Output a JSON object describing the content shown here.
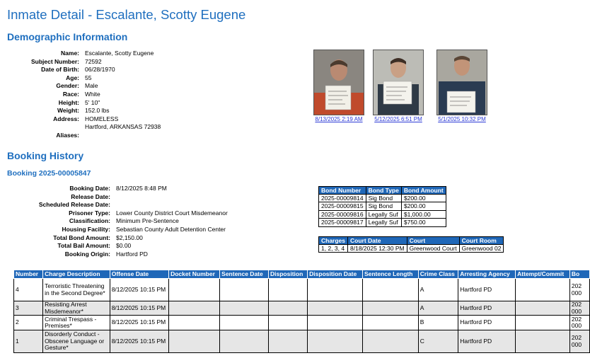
{
  "page_title": "Inmate Detail - Escalante, Scotty Eugene",
  "demographic": {
    "heading": "Demographic Information",
    "rows": [
      {
        "label": "Name:",
        "value": "Escalante, Scotty Eugene"
      },
      {
        "label": "Subject Number:",
        "value": "72592"
      },
      {
        "label": "Date of Birth:",
        "value": "06/28/1970"
      },
      {
        "label": "Age:",
        "value": "55"
      },
      {
        "label": "Gender:",
        "value": "Male"
      },
      {
        "label": "Race:",
        "value": "White"
      },
      {
        "label": "Height:",
        "value": "5' 10\""
      },
      {
        "label": "Weight:",
        "value": "152.0 lbs"
      },
      {
        "label": "Address:",
        "value": "HOMELESS"
      },
      {
        "label": "",
        "value": "Hartford, ARKANSAS 72938"
      },
      {
        "label": "Aliases:",
        "value": ""
      }
    ]
  },
  "photos": [
    {
      "date": "8/13/2025 2:19 AM"
    },
    {
      "date": "5/12/2025 6:51 PM"
    },
    {
      "date": "5/1/2025 10:32 PM"
    }
  ],
  "booking_history": {
    "heading": "Booking History",
    "booking_title": "Booking 2025-00005847",
    "rows": [
      {
        "label": "Booking Date:",
        "value": "8/12/2025 8:48 PM"
      },
      {
        "label": "Release Date:",
        "value": ""
      },
      {
        "label": "Scheduled Release Date:",
        "value": ""
      },
      {
        "label": "Prisoner Type:",
        "value": "Lower County District Court Misdemeanor"
      },
      {
        "label": "Classification:",
        "value": "Minimum Pre-Sentence"
      },
      {
        "label": "Housing Facility:",
        "value": "Sebastian County Adult Detention Center"
      },
      {
        "label": "Total Bond Amount:",
        "value": "$2,150.00"
      },
      {
        "label": "Total Bail Amount:",
        "value": "$0.00"
      },
      {
        "label": "Booking Origin:",
        "value": "Hartford PD"
      }
    ]
  },
  "bonds": {
    "headers": [
      "Bond Number",
      "Bond Type",
      "Bond Amount"
    ],
    "rows": [
      [
        "2025-00009814",
        "Sig Bond",
        "$200.00"
      ],
      [
        "2025-00009815",
        "Sig Bond",
        "$200.00"
      ],
      [
        "2025-00009816",
        "Legally Suf",
        "$1,000.00"
      ],
      [
        "2025-00009817",
        "Legally Suf",
        "$750.00"
      ]
    ]
  },
  "court": {
    "headers": [
      "Charges",
      "Court Date",
      "Court",
      "Court Room"
    ],
    "rows": [
      [
        "1, 2, 3, 4",
        "8/18/2025 12:30 PM",
        "Greenwood Court",
        "Greenwood 02"
      ]
    ]
  },
  "charges": {
    "headers": [
      "Number",
      "Charge Description",
      "Offense Date",
      "Docket Number",
      "Sentence Date",
      "Disposition",
      "Disposition Date",
      "Sentence Length",
      "Crime Class",
      "Arresting Agency",
      "Attempt/Commit",
      "Bo"
    ],
    "rows": [
      [
        "4",
        "Terroristic Threatening in the Second Degree*",
        "8/12/2025 10:15 PM",
        "",
        "",
        "",
        "",
        "",
        "A",
        "Hartford PD",
        "",
        "202 000"
      ],
      [
        "3",
        "Resisting Arrest Misdemeanor*",
        "8/12/2025 10:15 PM",
        "",
        "",
        "",
        "",
        "",
        "A",
        "Hartford PD",
        "",
        "202 000"
      ],
      [
        "2",
        "Criminal Trespass - Premises*",
        "8/12/2025 10:15 PM",
        "",
        "",
        "",
        "",
        "",
        "B",
        "Hartford PD",
        "",
        "202 000"
      ],
      [
        "1",
        "Disorderly Conduct - Obscene Language or Gesture*",
        "8/12/2025 10:15 PM",
        "",
        "",
        "",
        "",
        "",
        "C",
        "Hartford PD",
        "",
        "202 000"
      ]
    ]
  }
}
